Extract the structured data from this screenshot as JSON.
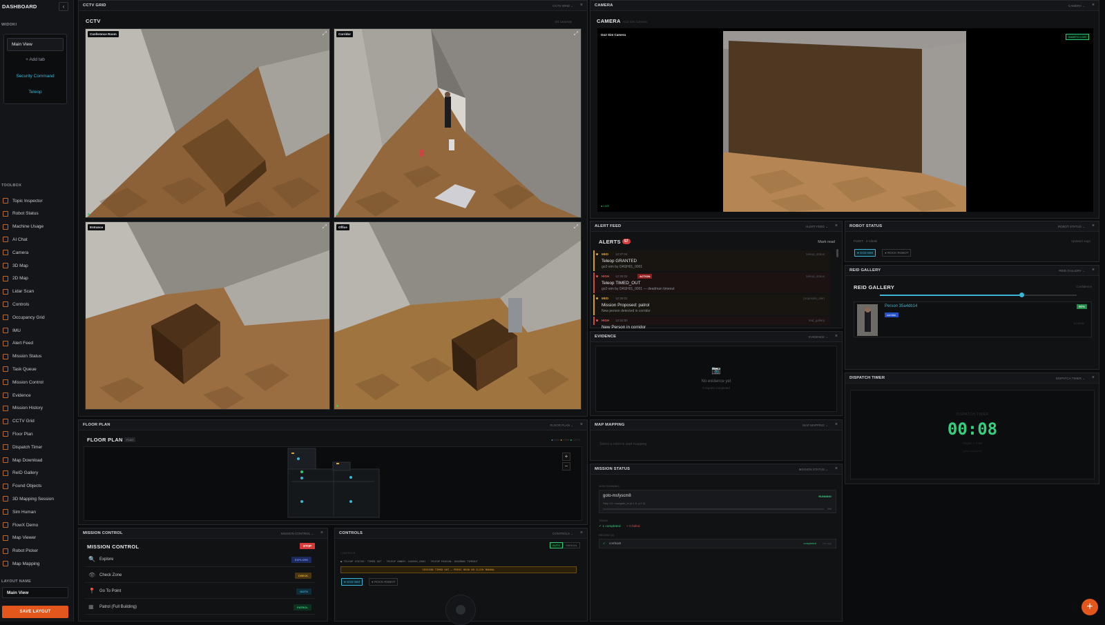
{
  "sidebar": {
    "title": "DASHBOARD",
    "collapse_glyph": "‹",
    "widoki_label": "WIDOKI",
    "tabs": {
      "main": "Main View",
      "add": "Add tab",
      "security": "Security Command",
      "teleop": "Teleop"
    },
    "toolbox_label": "TOOLBOX",
    "tools": [
      "Topic Inspector",
      "Robot Status",
      "Machine Usage",
      "AI Chat",
      "Camera",
      "3D Map",
      "2D Map",
      "Lidar Scan",
      "Controls",
      "Occupancy Grid",
      "IMU",
      "Alert Feed",
      "Mission Status",
      "Task Queue",
      "Mission Control",
      "Evidence",
      "Mission History",
      "CCTV Grid",
      "Floor Plan",
      "Dispatch Timer",
      "Map Download",
      "ReID Gallery",
      "Found Objects",
      "3D Mapping Session",
      "Sim Human",
      "FlowX Demo",
      "Map Viewer",
      "Robot Picker",
      "Map Mapping"
    ],
    "layout_name_label": "LAYOUT NAME",
    "layout_name_value": "Main View",
    "save_label": "SAVE LAYOUT"
  },
  "cctv": {
    "panel_title": "CCTV GRID",
    "panel_select": "CCTV GRID ⌄",
    "inner_title": "CCTV",
    "count": "4/4 cameras",
    "cams": [
      "Conference Room",
      "Corridor",
      "Entrance",
      "Office"
    ]
  },
  "camera": {
    "panel_title": "CAMERA",
    "panel_select": "CAMERA ⌄",
    "inner_title": "CAMERA",
    "inner_sub": "Go2 Sim Camera",
    "feed_label": "Go2 Sim Camera",
    "badge": "WebRTC LIVE",
    "live": "LIVE"
  },
  "alert_feed": {
    "panel_title": "ALERT FEED",
    "panel_select": "ALERT FEED ⌄",
    "inner_title": "ALERTS",
    "count": "57",
    "mark_read": "Mark read",
    "items": [
      {
        "sev": "MED",
        "time": "12:37:04",
        "title": "Teleop GRANTED",
        "sub": "go2-sim by DASH01_0001",
        "src": "teleop_status",
        "tag": ""
      },
      {
        "sev": "HIGH",
        "time": "12:35:22",
        "title": "Teleop TIMED_OUT",
        "sub": "go2-sim by DASH01_0001 — deadman timeout",
        "src": "teleop_status",
        "tag": "ACTION"
      },
      {
        "sev": "MED",
        "time": "12:35:01",
        "title": "Mission Proposed: patrol",
        "sub": "New person detected in corridor",
        "src": "proposals_alert",
        "tag": ""
      },
      {
        "sev": "HIGH",
        "time": "12:34:50",
        "title": "New Person in corridor",
        "sub": "",
        "src": "reid_gallery",
        "tag": ""
      }
    ]
  },
  "robot_status": {
    "panel_title": "ROBOT STATUS",
    "panel_select": "ROBOT STATUS ⌄",
    "fleet": "FLEET · 2 robots",
    "updated": "Updated 4ago",
    "chips": [
      "GO2-SIM",
      "ROCK-ROBOT"
    ]
  },
  "reid": {
    "panel_title": "REID GALLERY",
    "panel_select": "REID GALLERY ⌄",
    "inner_title": "REID GALLERY",
    "slider_label": "Confidence",
    "slider_value": 0.72,
    "person": "Person 35a4db14",
    "score": "90%",
    "tag": "corridor",
    "time": "12:34:50"
  },
  "evidence": {
    "panel_title": "EVIDENCE",
    "panel_select": "EVIDENCE ⌄",
    "empty_icon": "📷",
    "empty_title": "No evidence yet",
    "empty_sub": "0 reports completed"
  },
  "dispatch": {
    "panel_title": "DISPATCH TIMER",
    "panel_select": "DISPATCH TIMER ⌄",
    "label": "DISPATCH TIMER",
    "time": "00:08",
    "target": "Target: < 2:00",
    "sub": "goto-msfyscm8"
  },
  "floor_plan": {
    "panel_title": "FLOOR PLAN",
    "panel_select": "FLOOR PLAN ⌄",
    "inner_title": "FLOOR PLAN",
    "badge": "FLAG",
    "legend": [
      "GO2",
      "ITEM",
      "CCTV"
    ],
    "zoom_in": "+",
    "zoom_out": "−"
  },
  "map_mapping": {
    "panel_title": "MAP MAPPING",
    "panel_select": "MAP MAPPING ⌄",
    "hint": "Select a robot to start mapping"
  },
  "mission_status": {
    "panel_title": "MISSION STATUS",
    "panel_select": "MISSION STATUS ⌄",
    "now_running": "NOW RUNNING",
    "mission": "goto-msfyscm8",
    "state": "RUNNING",
    "step": "Step 1/1: navigate_to",
    "step_detail": "(x:1.5, y:2.0)",
    "progress_pct": "0%",
    "progress": 0.0,
    "today": "TODAY",
    "completed": "✓ 1 completed",
    "failed": "× 0 failed",
    "recent": "RECENT (1)",
    "recent_item": "corrhack",
    "recent_state": "completed",
    "recent_time": "2m ago"
  },
  "mission_control": {
    "panel_title": "MISSION CONTROL",
    "panel_select": "MISSION CONTROL ⌄",
    "inner_title": "MISSION CONTROL",
    "stop": "STOP",
    "rows": [
      {
        "icon": "🔍",
        "label": "Explore",
        "tag": "EXPLORE"
      },
      {
        "icon": "👁",
        "label": "Check Zone",
        "tag": "CHECK"
      },
      {
        "icon": "📍",
        "label": "Go To Point",
        "tag": "GOTO"
      },
      {
        "icon": "▦",
        "label": "Patrol (Full Building)",
        "tag": "PATROL"
      }
    ]
  },
  "controls": {
    "panel_title": "CONTROLS",
    "panel_select": "CONTROLS ⌄",
    "mode_on": "AUTO",
    "mode_off": "MANUAL",
    "label": "CONTROLS",
    "status_line": "● TELEOP STATUS: TIMED OUT · TELEOP OWNER: DASH01_0001 · TELEOP REASON: DEADMAN TIMEOUT",
    "warning": "SESSION TIMED OUT — PRESS HEAD OR CLICK MANUAL",
    "chips": [
      "GO2-SIM",
      "ROCK-ROBOT"
    ]
  },
  "fab": "+"
}
